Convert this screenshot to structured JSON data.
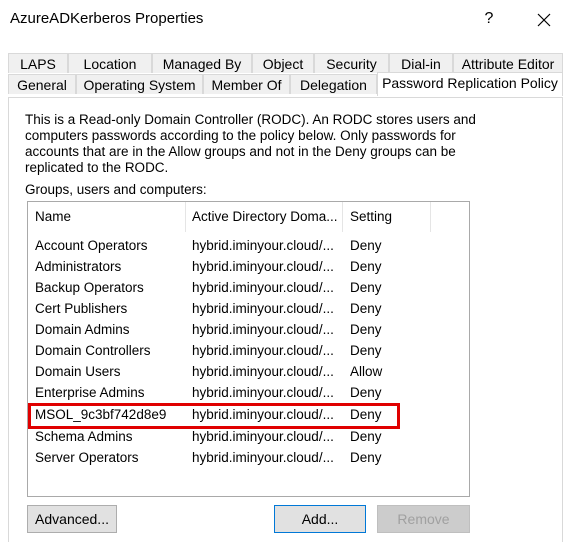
{
  "window": {
    "title": "AzureADKerberos Properties",
    "help": "?"
  },
  "tabs_row1": [
    "LAPS",
    "Location",
    "Managed By",
    "Object",
    "Security",
    "Dial-in",
    "Attribute Editor"
  ],
  "tabs_row2": [
    "General",
    "Operating System",
    "Member Of",
    "Delegation",
    "Password Replication Policy"
  ],
  "active_tab": "Password Replication Policy",
  "description": "This is a Read-only Domain Controller (RODC).  An RODC stores users and computers passwords according to the policy below.  Only passwords for accounts that are in the Allow groups and not in the Deny groups can be replicated to the RODC.",
  "list_label": "Groups, users and computers:",
  "columns": [
    "Name",
    "Active Directory Doma...",
    "Setting"
  ],
  "rows": [
    {
      "name": "Account Operators",
      "domain": "hybrid.iminyour.cloud/...",
      "setting": "Deny"
    },
    {
      "name": "Administrators",
      "domain": "hybrid.iminyour.cloud/...",
      "setting": "Deny"
    },
    {
      "name": "Backup Operators",
      "domain": "hybrid.iminyour.cloud/...",
      "setting": "Deny"
    },
    {
      "name": "Cert Publishers",
      "domain": "hybrid.iminyour.cloud/...",
      "setting": "Deny"
    },
    {
      "name": "Domain Admins",
      "domain": "hybrid.iminyour.cloud/...",
      "setting": "Deny"
    },
    {
      "name": "Domain Controllers",
      "domain": "hybrid.iminyour.cloud/...",
      "setting": "Deny"
    },
    {
      "name": "Domain Users",
      "domain": "hybrid.iminyour.cloud/...",
      "setting": "Allow"
    },
    {
      "name": "Enterprise Admins",
      "domain": "hybrid.iminyour.cloud/...",
      "setting": "Deny"
    },
    {
      "name": "MSOL_9c3bf742d8e9",
      "domain": "hybrid.iminyour.cloud/...",
      "setting": "Deny"
    },
    {
      "name": "Schema Admins",
      "domain": "hybrid.iminyour.cloud/...",
      "setting": "Deny"
    },
    {
      "name": "Server Operators",
      "domain": "hybrid.iminyour.cloud/...",
      "setting": "Deny"
    }
  ],
  "highlight_color": "#e00000",
  "buttons": {
    "advanced": "Advanced...",
    "add": "Add...",
    "remove": "Remove"
  }
}
